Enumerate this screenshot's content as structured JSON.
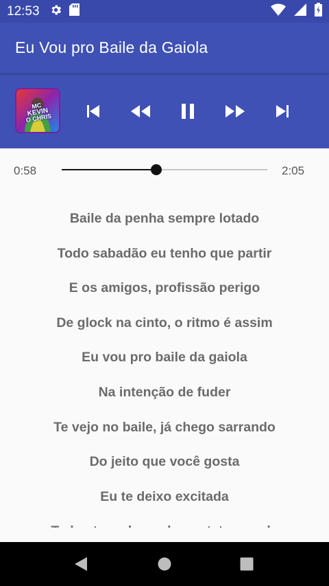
{
  "status_bar": {
    "time": "12:53",
    "icons": [
      "gear-icon",
      "sd-card-icon",
      "wifi-icon",
      "signal-icon",
      "battery-icon"
    ]
  },
  "app_bar": {
    "title": "Eu Vou pro Baile da Gaiola"
  },
  "player": {
    "album_art_text": [
      "MC",
      "KEVIN",
      "O CHRIS"
    ],
    "controls": [
      "skip-previous-icon",
      "rewind-icon",
      "pause-icon",
      "fast-forward-icon",
      "skip-next-icon"
    ],
    "elapsed": "0:58",
    "duration": "2:05",
    "progress_fraction": 0.46
  },
  "lyrics": [
    "Baile da penha sempre lotado",
    "Todo sabadão eu tenho que partir",
    "E os amigos, profissão perigo",
    "De glock na cinto, o ritmo é assim",
    "Eu vou pro baile da gaiola",
    "Na intenção de fuder",
    "Te vejo no baile, já chego sarrando",
    "Do jeito que você gosta",
    "Eu te deixo excitada",
    "Tu besta na boca do contato manda"
  ],
  "colors": {
    "status_bar": "#3949ab",
    "app_bar": "#3f51b5",
    "lyric_text": "#6b6b6b",
    "background": "#fafafa",
    "nav_bar": "#000000"
  }
}
